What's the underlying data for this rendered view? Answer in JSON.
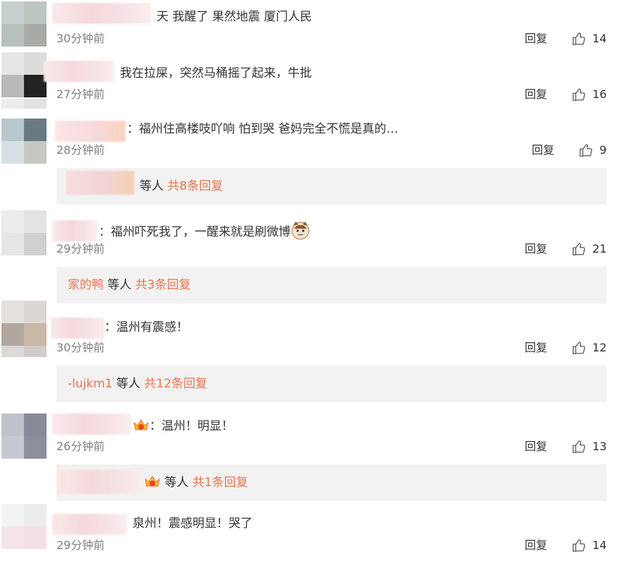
{
  "reply_label": "回复",
  "comments": [
    {
      "text": "天 我醒了 果然地震 厦门人民",
      "time": "30分钟前",
      "likes": "14"
    },
    {
      "text": "我在拉屎，突然马桶摇了起来，牛批",
      "time": "27分钟前",
      "likes": "16"
    },
    {
      "text": "：福州住高楼吱吖响 怕到哭 爸妈完全不慌是真的…",
      "time": "28分钟前",
      "likes": "9",
      "subreply": {
        "prefix": "",
        "middle": "等人",
        "total": "共8条回复"
      }
    },
    {
      "text": "：福州吓死我了，一醒来就是刷微博",
      "time": "29分钟前",
      "likes": "21",
      "subreply": {
        "prefix": "家的鸭",
        "middle": "等人",
        "total": "共3条回复"
      }
    },
    {
      "text": "：温州有震感！",
      "time": "30分钟前",
      "likes": "12",
      "subreply": {
        "prefix": "-lujkm1",
        "middle": "等人",
        "total": "共12条回复"
      }
    },
    {
      "text": "：温州！明显！",
      "time": "26分钟前",
      "likes": "13",
      "subreply": {
        "prefix": "",
        "middle": "等人",
        "total": "共1条回复"
      }
    },
    {
      "text": "泉州！震感明显！哭了",
      "time": "29分钟前",
      "likes": "14"
    }
  ],
  "icons": {
    "like": "thumbs-up-icon",
    "vip": "vip-crown-icon",
    "emoji": "cat-emoji-icon"
  },
  "colors": {
    "link": "#eb7350",
    "time": "#808080",
    "subreply_bg": "#f2f2f2"
  }
}
